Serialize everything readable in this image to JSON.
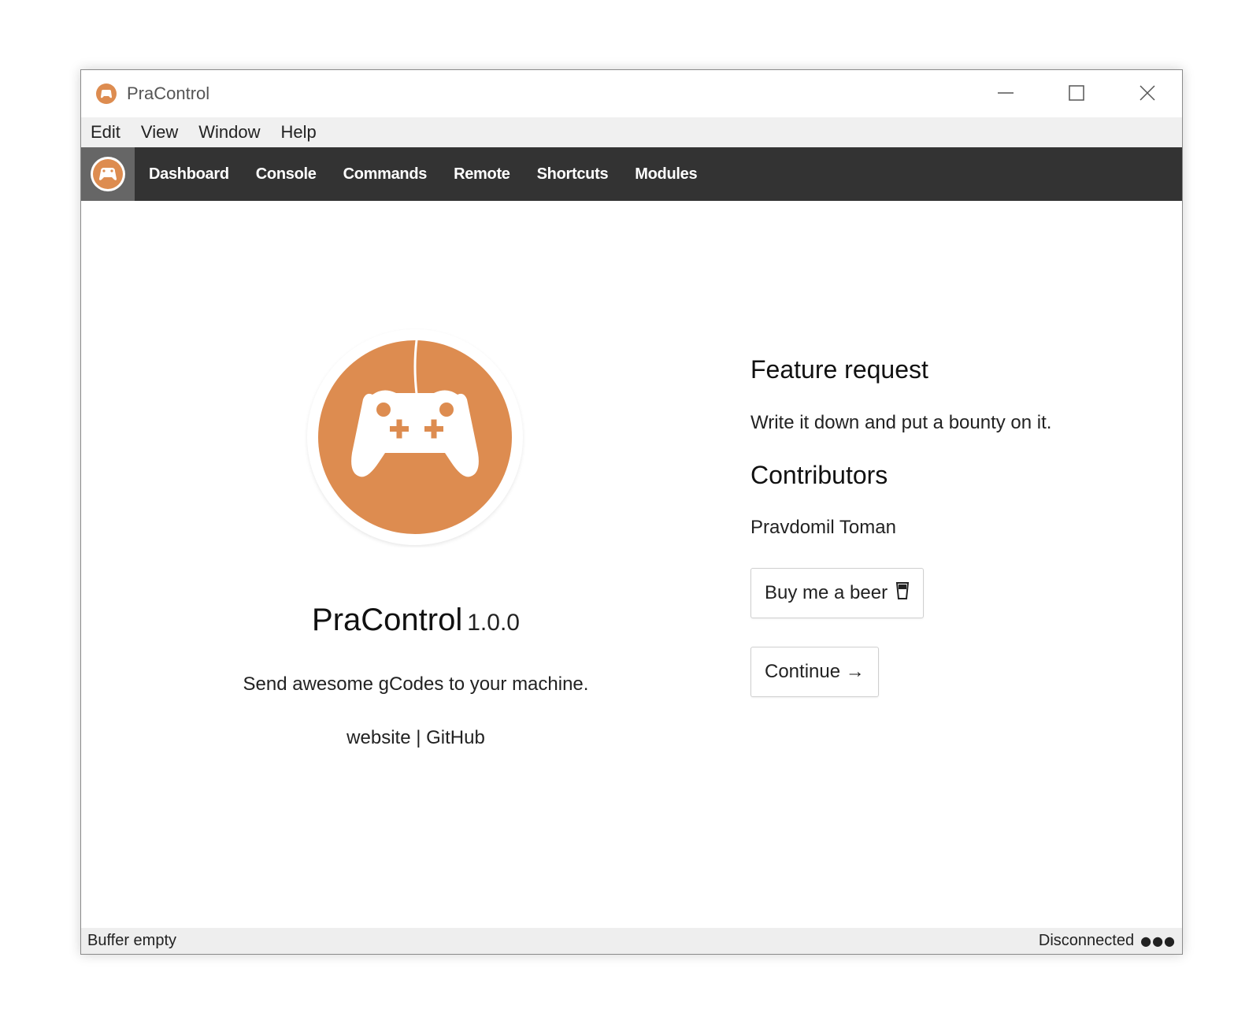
{
  "window": {
    "title": "PraControl"
  },
  "menu": {
    "items": [
      "Edit",
      "View",
      "Window",
      "Help"
    ]
  },
  "nav": {
    "links": [
      "Dashboard",
      "Console",
      "Commands",
      "Remote",
      "Shortcuts",
      "Modules"
    ]
  },
  "about": {
    "app_name": "PraControl",
    "version": "1.0.0",
    "tagline": "Send awesome gCodes to your machine.",
    "link_website": "website",
    "link_separator": "|",
    "link_github": "GitHub"
  },
  "feature": {
    "heading": "Feature request",
    "text": "Write it down and put a bounty on it."
  },
  "contributors": {
    "heading": "Contributors",
    "name": "Pravdomil Toman"
  },
  "buttons": {
    "beer_label": "Buy me a beer",
    "beer_glyph": "🍺",
    "continue_label": "Continue →"
  },
  "status": {
    "left": "Buffer empty",
    "right": "Disconnected",
    "indicator": "●●●"
  },
  "colors": {
    "accent": "#dd8c50",
    "navbar": "#333333",
    "brand_bg": "#666666"
  },
  "icons": {
    "app": "gamepad-icon"
  }
}
